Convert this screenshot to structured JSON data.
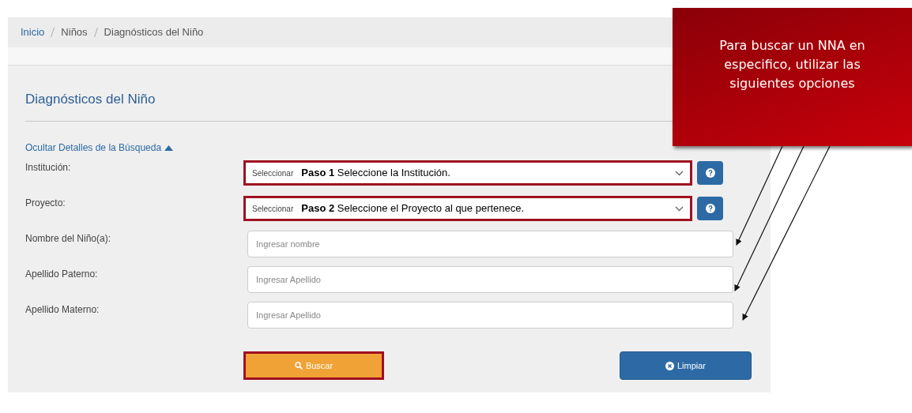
{
  "breadcrumb": [
    {
      "label": "Inicio",
      "kind": "link"
    },
    {
      "label": "Niños",
      "kind": "text"
    },
    {
      "label": "Diagnósticos del Niño",
      "kind": "text"
    }
  ],
  "panel": {
    "title": "Diagnósticos del Niño",
    "toggle": {
      "label": "Ocultar Detalles de la Búsqueda",
      "expanded": true
    }
  },
  "fields": [
    {
      "label": "Institución:",
      "kind": "select",
      "value": "Seleccionar",
      "annotation": "**Paso 1** Seleccione la Institución.",
      "highlighted": true
    },
    {
      "label": "Proyecto:",
      "kind": "select",
      "value": "Seleccionar",
      "annotation": "**Paso 2** Seleccione el Proyecto al que pertenece.",
      "highlighted": true
    },
    {
      "label": "Nombre del Niño(a):",
      "kind": "text",
      "placeholder": "Ingresar nombre",
      "highlighted": false
    },
    {
      "label": "Apellido Paterno:",
      "kind": "text",
      "placeholder": "Ingresar Apellido",
      "highlighted": false
    },
    {
      "label": "Apellido Materno:",
      "kind": "text",
      "placeholder": "Ingresar Apellido",
      "highlighted": false
    }
  ],
  "buttons": [
    {
      "label": "Buscar",
      "kind": "search",
      "highlighted": true
    },
    {
      "label": "Limpiar",
      "kind": "clear",
      "highlighted": false
    }
  ],
  "callout": {
    "text": "Para buscar un NNA en especifico, utilizar las siguientes opciones"
  }
}
